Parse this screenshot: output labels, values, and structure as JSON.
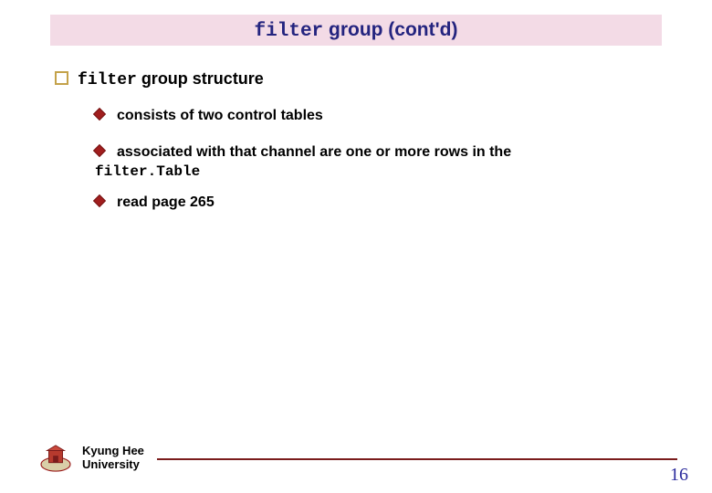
{
  "title": {
    "code": "filter",
    "rest": " group (cont'd)"
  },
  "section": {
    "heading": {
      "code": "filter",
      "rest": " group structure"
    },
    "items": [
      {
        "text": "consists of two control tables"
      },
      {
        "text": "associated with that channel are one or more rows in the",
        "sub_code": "filter.Table"
      },
      {
        "text": "read page 265"
      }
    ]
  },
  "footer": {
    "university_line1": "Kyung Hee",
    "university_line2": "University",
    "page_number": "16"
  }
}
